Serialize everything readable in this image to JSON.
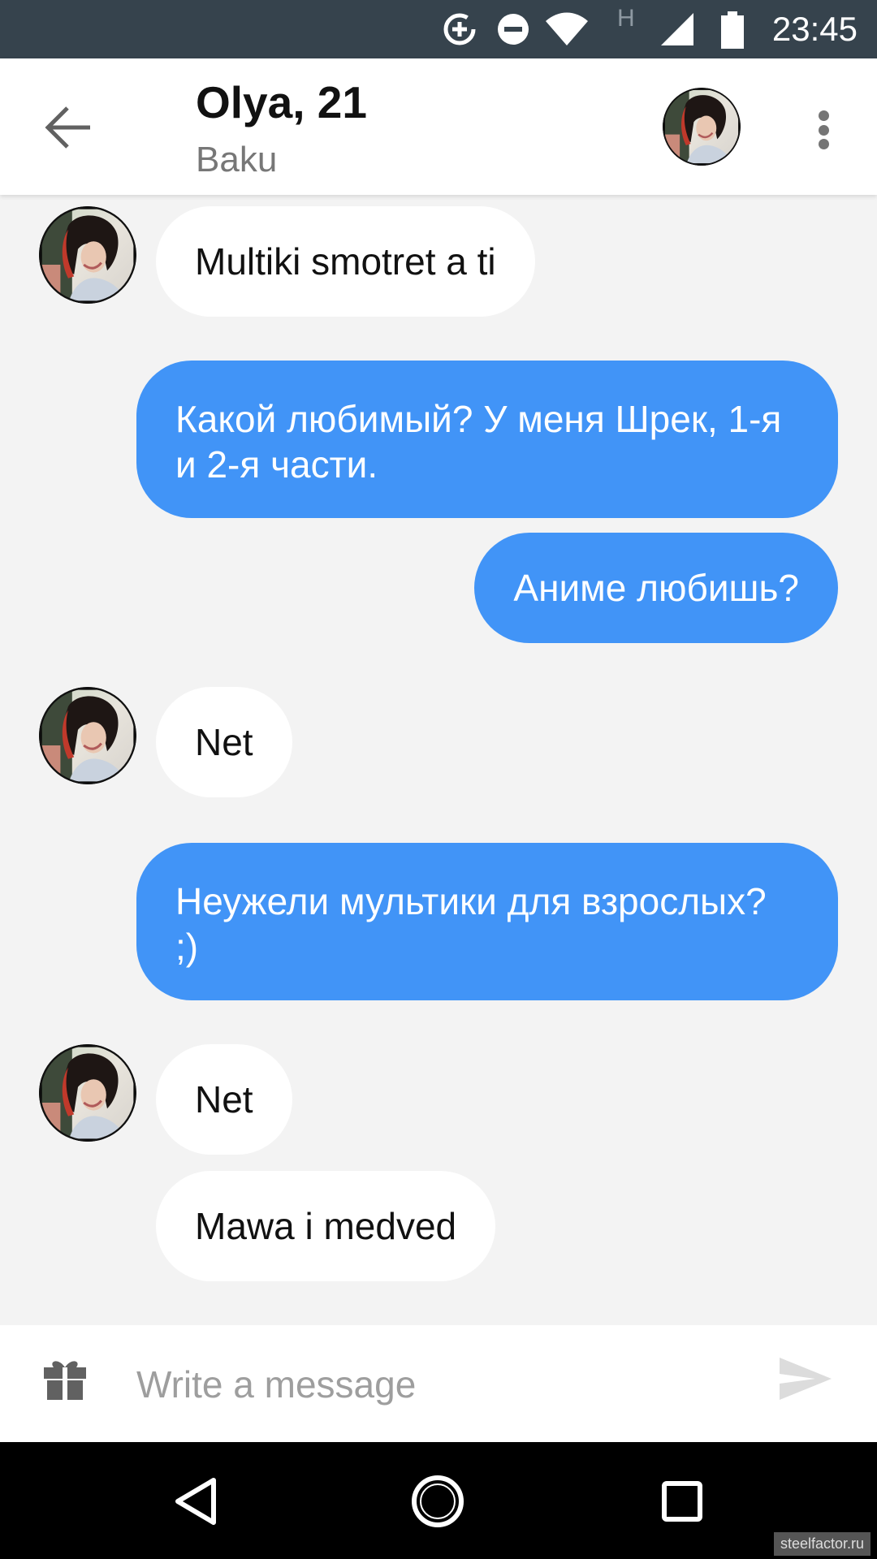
{
  "status_bar": {
    "time": "23:45",
    "network_type": "H",
    "icons": [
      "data-saver-icon",
      "do-not-disturb-icon",
      "wifi-icon",
      "cell-signal-icon",
      "battery-icon"
    ]
  },
  "header": {
    "title": "Olya, 21",
    "subtitle": "Baku",
    "back_icon": "arrow-back-icon",
    "menu_icon": "more-vert-icon"
  },
  "messages": [
    {
      "direction": "incoming",
      "text": "Multiki smotret a ti",
      "show_avatar": true
    },
    {
      "direction": "outgoing",
      "text": "Какой любимый? У меня Шрек, 1-я и 2-я части."
    },
    {
      "direction": "outgoing",
      "text": "Аниме любишь?"
    },
    {
      "direction": "incoming",
      "text": "Net",
      "show_avatar": true
    },
    {
      "direction": "outgoing",
      "text": "Неужели мультики для взрослых? ;)"
    },
    {
      "direction": "incoming",
      "text": "Net",
      "show_avatar": true
    },
    {
      "direction": "incoming",
      "text": "Mawa i medved",
      "show_avatar": false
    }
  ],
  "composer": {
    "placeholder": "Write a message",
    "value": "",
    "gift_icon": "gift-icon",
    "send_icon": "send-icon"
  },
  "nav_bar": {
    "icons": [
      "nav-back-icon",
      "nav-home-icon",
      "nav-recents-icon"
    ]
  },
  "watermark": "steelfactor.ru",
  "colors": {
    "status_bar_bg": "#36434d",
    "outgoing_bubble": "#4194f7",
    "incoming_bubble": "#ffffff",
    "chat_bg": "#f3f3f3"
  }
}
